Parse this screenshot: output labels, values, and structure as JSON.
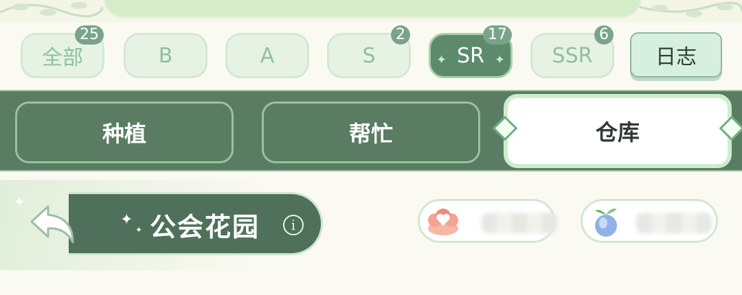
{
  "rarity_filters": [
    {
      "label": "全部",
      "count": "25",
      "active": false
    },
    {
      "label": "B",
      "count": "",
      "active": false
    },
    {
      "label": "A",
      "count": "",
      "active": false
    },
    {
      "label": "S",
      "count": "2",
      "active": false
    },
    {
      "label": "SR",
      "count": "17",
      "active": true
    },
    {
      "label": "SSR",
      "count": "6",
      "active": false
    }
  ],
  "log_label": "日志",
  "tabs": [
    {
      "label": "种植",
      "active": false
    },
    {
      "label": "帮忙",
      "active": false
    },
    {
      "label": "仓库",
      "active": true
    }
  ],
  "guild": {
    "name": "公会花园",
    "info_glyph": "i"
  },
  "currencies": [
    {
      "icon": "heart-flower-icon",
      "value_hidden": true
    },
    {
      "icon": "seed-bag-icon",
      "value_hidden": true
    }
  ],
  "colors": {
    "accent": "#597c63",
    "active_filter": "#5c8a6b",
    "badge": "#79a489",
    "background": "#fbfaf2"
  }
}
